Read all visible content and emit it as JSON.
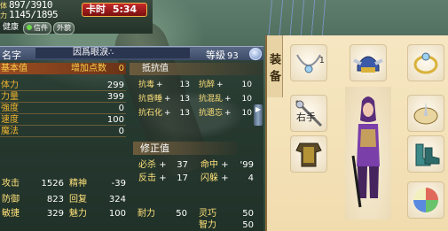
{
  "status": {
    "hp_label": "体",
    "mp_label": "力",
    "hp": "897/3910",
    "mp": "1145/1895",
    "timer_label": "卡时",
    "timer_value": "5:34",
    "tabs": [
      "健康",
      "信件",
      "外貌"
    ]
  },
  "character": {
    "name_key": "名字",
    "name": "因爲眼淚∴",
    "level_label": "等級",
    "level": "93"
  },
  "attributes": {
    "header": {
      "k": "基本值",
      "k2": "增加点数",
      "v": "0"
    },
    "rows": [
      {
        "k": "体力",
        "v": "299"
      },
      {
        "k": "力量",
        "v": "399"
      },
      {
        "k": "強度",
        "v": "0"
      },
      {
        "k": "速度",
        "v": "100"
      },
      {
        "k": "魔法",
        "v": "0"
      }
    ]
  },
  "resist": {
    "title": "抵抗值",
    "left": [
      {
        "k": "抗毒",
        "p": "+",
        "v": "13"
      },
      {
        "k": "抗昏睡",
        "p": "+",
        "v": "13"
      },
      {
        "k": "抗石化",
        "p": "+",
        "v": "13"
      }
    ],
    "right": [
      {
        "k": "抗醉",
        "p": "+",
        "v": "10"
      },
      {
        "k": "抗混乱",
        "p": "+",
        "v": "10"
      },
      {
        "k": "抗遗忘",
        "p": "+",
        "v": "10"
      }
    ]
  },
  "modifiers": {
    "title": "修正值",
    "left": [
      {
        "k": "必杀",
        "p": "+",
        "v": "37"
      },
      {
        "k": "反击",
        "p": "+",
        "v": "17"
      }
    ],
    "right": [
      {
        "k": "命中",
        "p": "+",
        "v": "'99"
      },
      {
        "k": "闪躲",
        "p": "+",
        "v": "4"
      }
    ]
  },
  "combat": {
    "left": [
      {
        "k": "攻击",
        "v": "1526",
        "k2": "精神",
        "v2": "-39"
      },
      {
        "k": "防御",
        "v": "823",
        "k2": "回复",
        "v2": "324"
      },
      {
        "k": "敏捷",
        "v": "329",
        "k2": "魅力",
        "v2": "100"
      }
    ],
    "right": [
      {
        "k": "耐力",
        "v": "50",
        "k2": "灵巧",
        "v2": "50"
      },
      {
        "k": "",
        "v": "",
        "k2": "智力",
        "v2": "50"
      }
    ]
  },
  "equipment": {
    "title": "装备",
    "slots": [
      "necklace",
      "helmet",
      "ring",
      "weapon",
      "accessory",
      "armor",
      "boots",
      "crystal"
    ],
    "slot_label_1": "1",
    "weapon_label": "右手"
  }
}
